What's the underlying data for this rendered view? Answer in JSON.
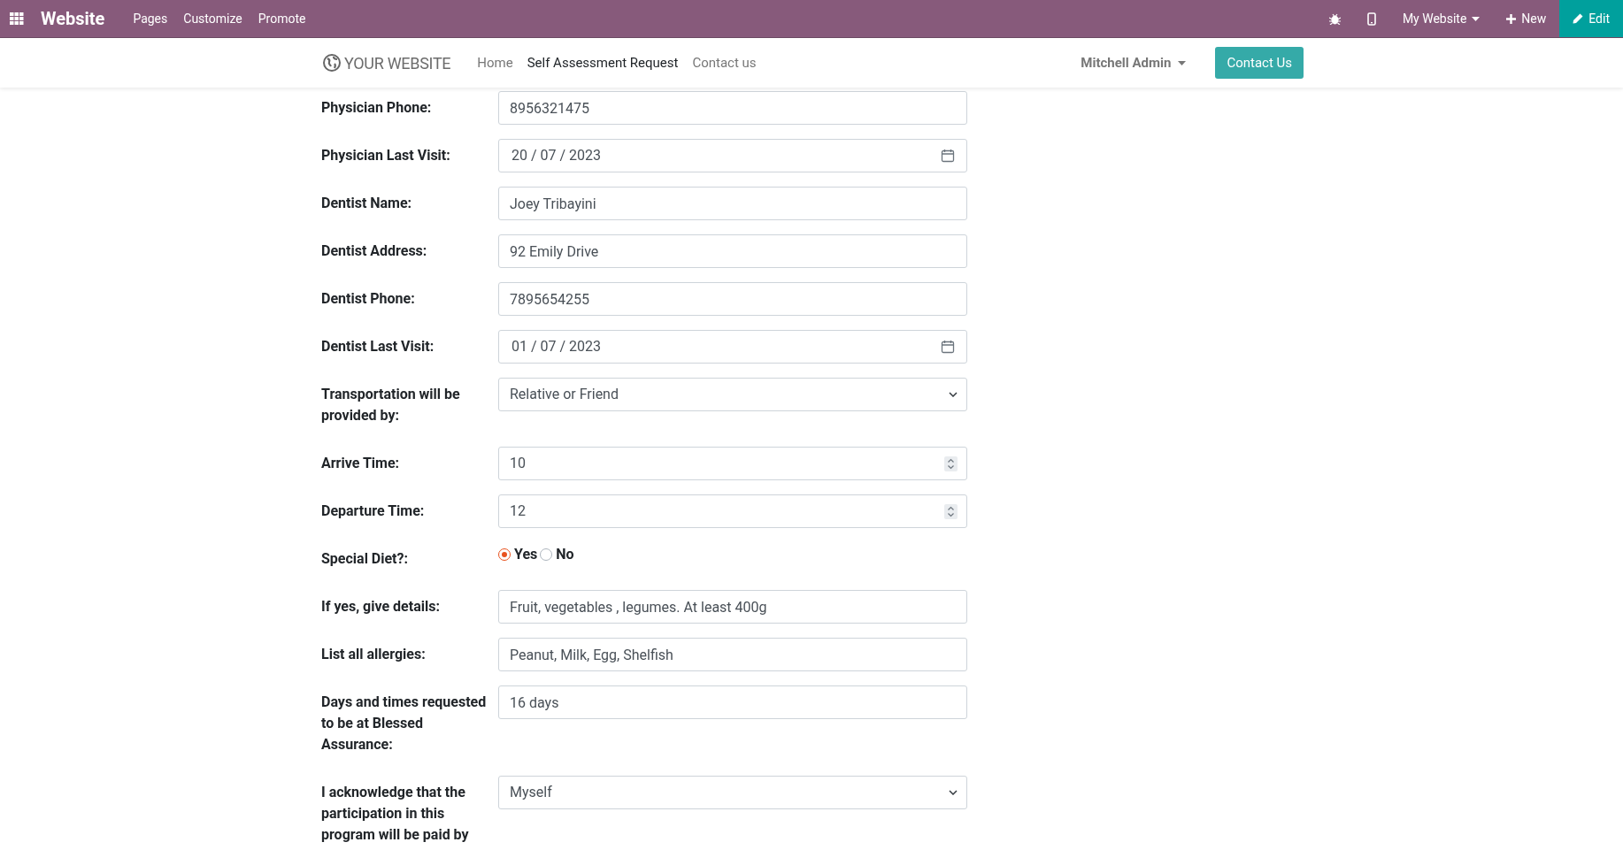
{
  "topbar": {
    "app_name": "Website",
    "menu": [
      "Pages",
      "Customize",
      "Promote"
    ],
    "site_switcher": "My Website",
    "new_button": "New",
    "edit_button": "Edit"
  },
  "navbar": {
    "logo": "YOUR WEBSITE",
    "links": [
      {
        "label": "Home",
        "selected": false
      },
      {
        "label": "Self Assessment Request",
        "selected": true
      },
      {
        "label": "Contact us",
        "selected": false
      }
    ],
    "user": "Mitchell Admin",
    "cta": "Contact Us"
  },
  "form": [
    {
      "kind": "text",
      "label": "Physician Phone:",
      "value": "8956321475"
    },
    {
      "kind": "date",
      "label": "Physician Last Visit:",
      "value": "20 / 07 / 2023"
    },
    {
      "kind": "text",
      "label": "Dentist Name:",
      "value": "Joey Tribayini"
    },
    {
      "kind": "text",
      "label": "Dentist Address:",
      "value": "92 Emily Drive"
    },
    {
      "kind": "text",
      "label": "Dentist Phone:",
      "value": "7895654255"
    },
    {
      "kind": "date",
      "label": "Dentist Last Visit:",
      "value": "01 / 07 / 2023"
    },
    {
      "kind": "select",
      "label": "Transportation will be provided by:",
      "value": "Relative or Friend"
    },
    {
      "kind": "number",
      "label": "Arrive Time:",
      "value": "10"
    },
    {
      "kind": "number",
      "label": "Departure Time:",
      "value": "12"
    },
    {
      "kind": "radio",
      "label": "Special Diet?:",
      "options": [
        {
          "label": "Yes",
          "selected": true
        },
        {
          "label": "No",
          "selected": false
        }
      ]
    },
    {
      "kind": "text",
      "label": "If yes, give details:",
      "value": "Fruit, vegetables , legumes. At least 400g"
    },
    {
      "kind": "text",
      "label": "List all allergies:",
      "value": "Peanut, Milk, Egg, Shelfish"
    },
    {
      "kind": "text",
      "label": "Days and times requested to be at Blessed Assurance:",
      "value": "16 days"
    },
    {
      "kind": "select",
      "label": "I acknowledge that the participation in this program will be paid by",
      "value": "Myself"
    }
  ]
}
